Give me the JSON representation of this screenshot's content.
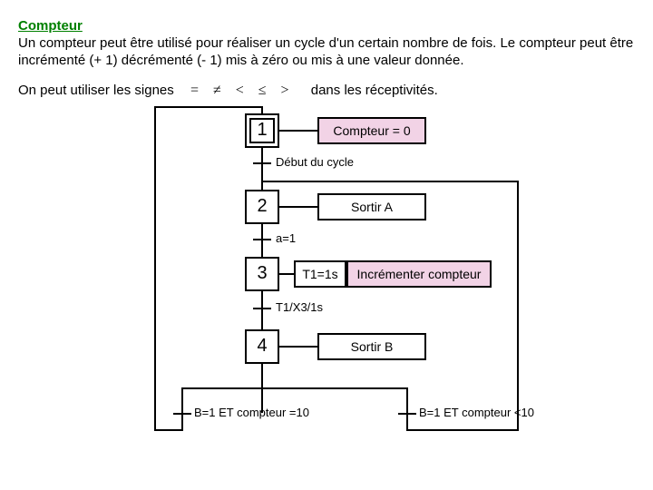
{
  "title": "Compteur",
  "intro": "Un compteur peut être utilisé pour réaliser un cycle d'un certain nombre de fois. Le compteur peut être incrémenté (+ 1) décrémenté (- 1) mis à zéro ou mis à une valeur donnée.",
  "signs_before": "On peut utiliser les signes",
  "signs": "= ≠ < ≤ >",
  "signs_after": "dans les réceptivités.",
  "grafcet": {
    "steps": [
      {
        "n": "1",
        "action": "Compteur = 0",
        "highlight": true,
        "initial": true
      },
      {
        "n": "2",
        "action": "Sortir A",
        "highlight": false,
        "initial": false
      },
      {
        "n": "3",
        "action_pre": "T1=1s",
        "action": "Incrémenter compteur",
        "highlight": true,
        "initial": false
      },
      {
        "n": "4",
        "action": "Sortir B",
        "highlight": false,
        "initial": false
      }
    ],
    "transitions": {
      "t1": "Début du cycle",
      "t2": "a=1",
      "t3": "T1/X3/1s",
      "branch_left": "B=1 ET compteur =10",
      "branch_right": "B=1 ET compteur <10"
    }
  }
}
